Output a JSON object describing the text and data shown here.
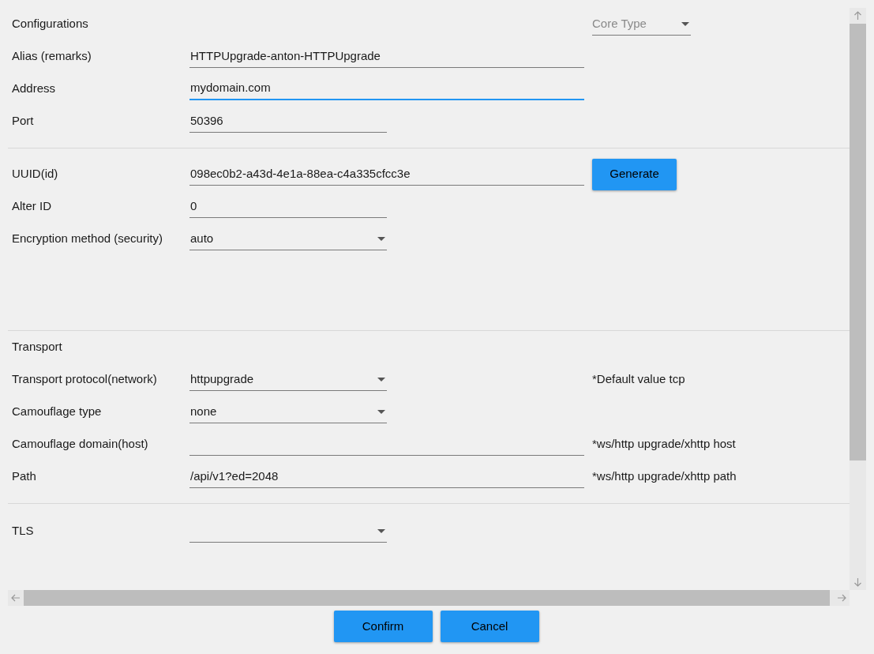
{
  "header": {
    "title": "Configurations",
    "core_type": {
      "placeholder": "Core Type"
    }
  },
  "sections": [
    {
      "rows": [
        {
          "label": "Alias (remarks)",
          "kind": "wide",
          "value": "HTTPUpgrade-anton-HTTPUpgrade",
          "focused": false
        },
        {
          "label": "Address",
          "kind": "wide",
          "value": "mydomain.com",
          "focused": true
        },
        {
          "label": "Port",
          "kind": "short",
          "value": "50396",
          "focused": false
        }
      ]
    },
    {
      "rows": [
        {
          "label": "UUID(id)",
          "kind": "wide",
          "value": "098ec0b2-a43d-4e1a-88ea-c4a335cfcc3e",
          "focused": false,
          "button": "Generate"
        },
        {
          "label": "Alter ID",
          "kind": "short",
          "value": "0",
          "focused": false
        },
        {
          "label": "Encryption method (security)",
          "kind": "dropdown",
          "value": "auto",
          "focused": false
        }
      ]
    },
    {
      "title": "Transport",
      "rows": [
        {
          "label": "Transport protocol(network)",
          "kind": "dropdown",
          "value": "httpupgrade",
          "focused": false,
          "note": "*Default value tcp"
        },
        {
          "label": "Camouflage type",
          "kind": "dropdown",
          "value": "none",
          "focused": false
        },
        {
          "label": "Camouflage domain(host)",
          "kind": "wide",
          "value": "",
          "focused": false,
          "note": "*ws/http upgrade/xhttp host"
        },
        {
          "label": "Path",
          "kind": "wide",
          "value": "/api/v1?ed=2048",
          "focused": false,
          "note": "*ws/http upgrade/xhttp path"
        }
      ]
    },
    {
      "rows": [
        {
          "label": "TLS",
          "kind": "dropdown",
          "value": "",
          "focused": false
        }
      ]
    }
  ],
  "buttons": [
    "Confirm",
    "Cancel"
  ]
}
